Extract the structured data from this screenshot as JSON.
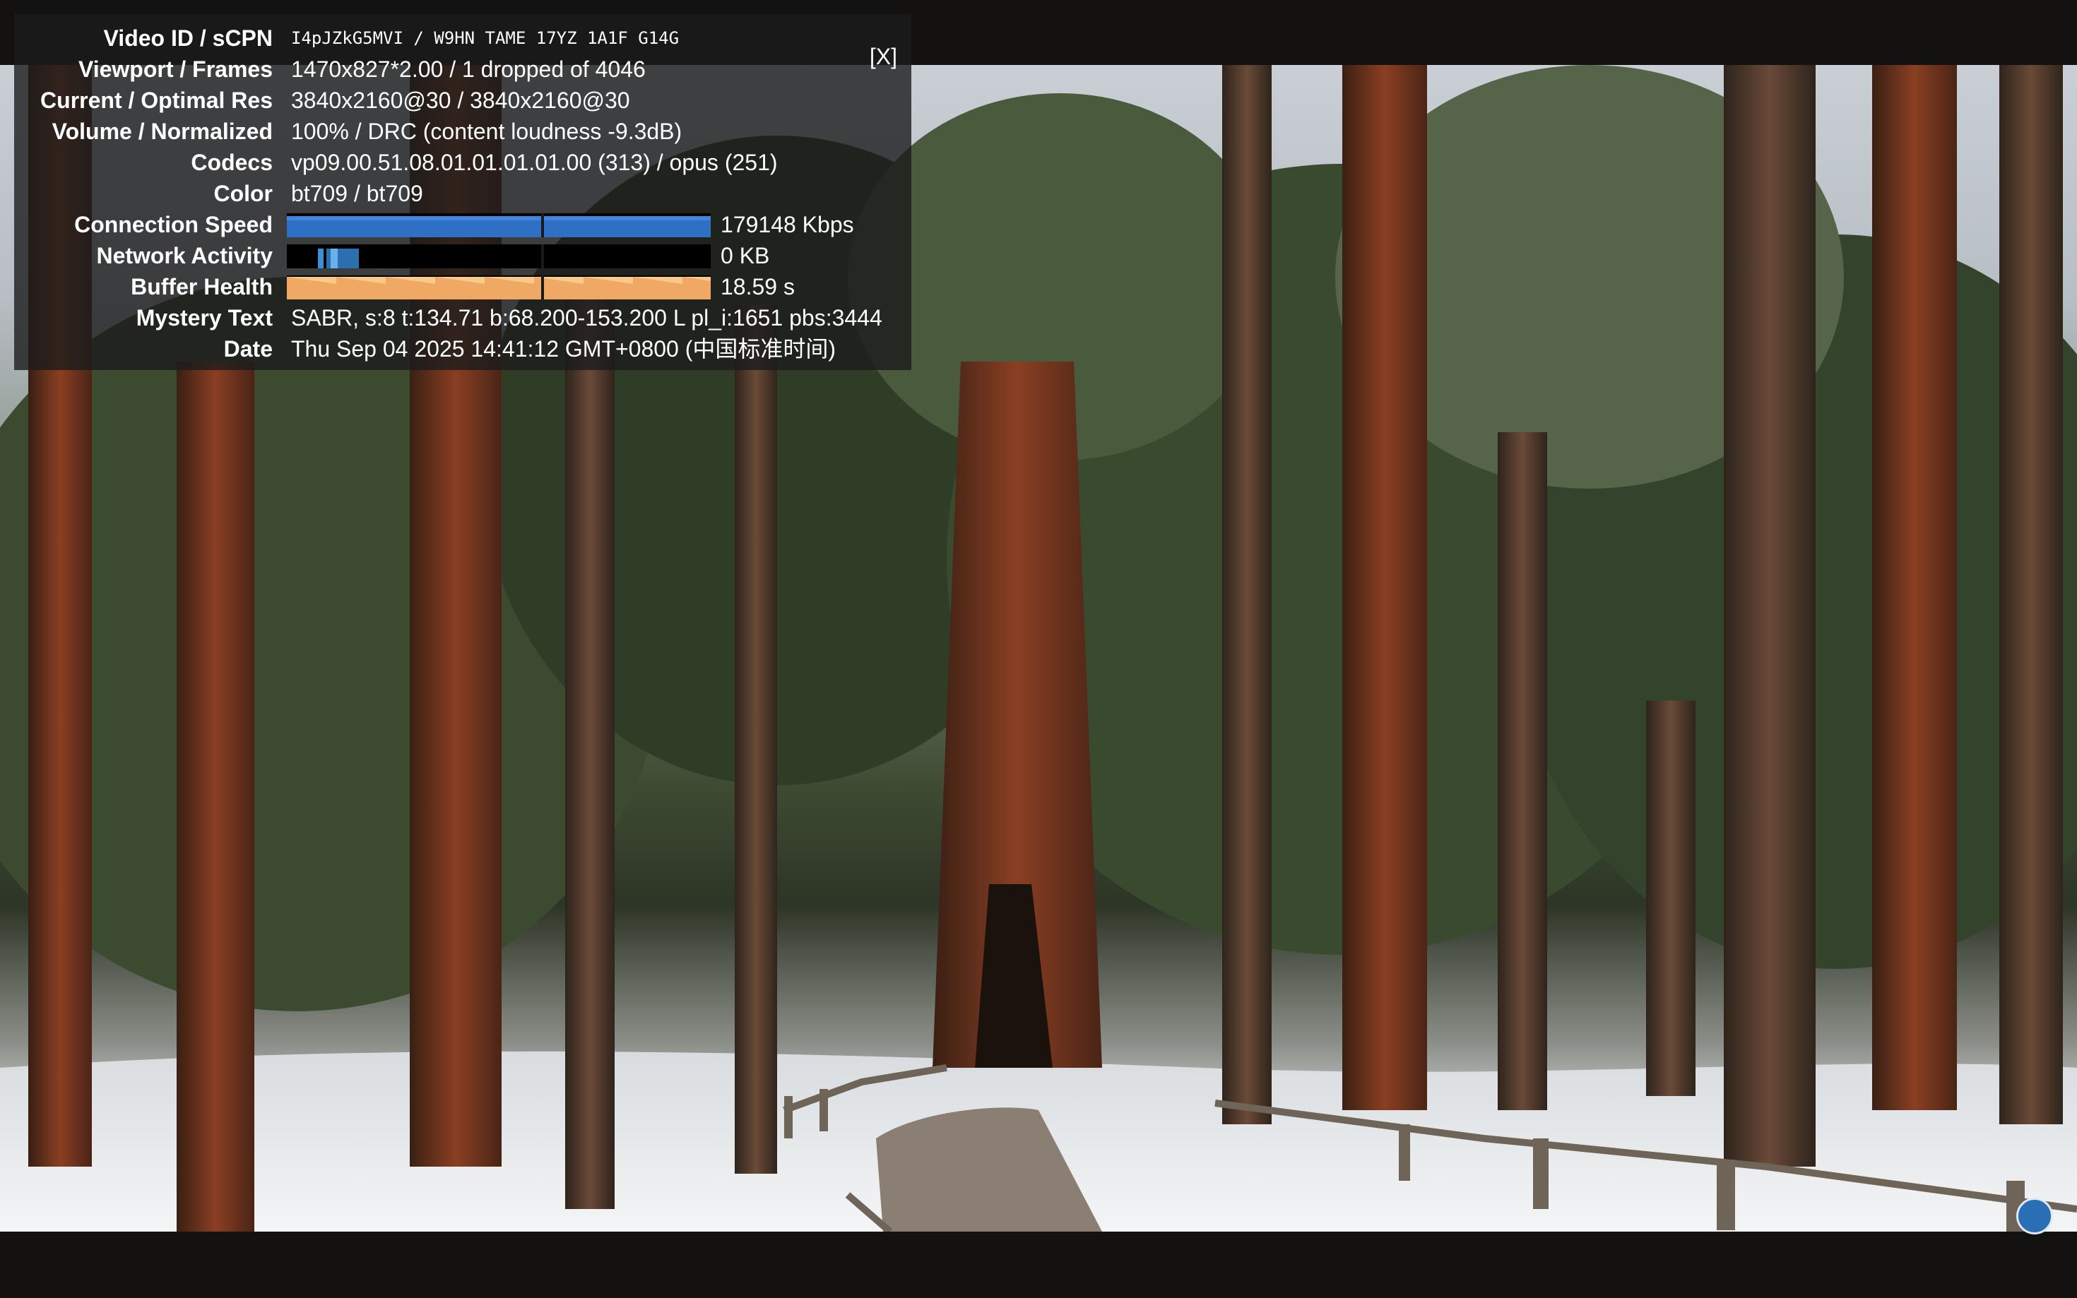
{
  "stats": {
    "close_label": "[X]",
    "rows": [
      {
        "label": "Video ID / sCPN",
        "value": "I4pJZkG5MVI / W9HN TAME 17YZ 1A1F G14G"
      },
      {
        "label": "Viewport / Frames",
        "value": "1470x827*2.00 / 1 dropped of 4046"
      },
      {
        "label": "Current / Optimal Res",
        "value": "3840x2160@30 / 3840x2160@30"
      },
      {
        "label": "Volume / Normalized",
        "value": "100% / DRC (content loudness -9.3dB)"
      },
      {
        "label": "Codecs",
        "value": "vp09.00.51.08.01.01.01.01.00 (313) / opus (251)"
      },
      {
        "label": "Color",
        "value": "bt709 / bt709"
      },
      {
        "label": "Connection Speed",
        "value": "179148 Kbps"
      },
      {
        "label": "Network Activity",
        "value": "0 KB"
      },
      {
        "label": "Buffer Health",
        "value": "18.59 s"
      },
      {
        "label": "Mystery Text",
        "value": "SABR, s:8 t:134.71 b:68.200-153.200 L pl_i:1651 pbs:3444"
      },
      {
        "label": "Date",
        "value": "Thu Sep 04 2025 14:41:12 GMT+0800 (中国标准时间)"
      }
    ]
  },
  "colors": {
    "connection_graph": "#2f6fc4",
    "network_graph": "#3c8fd6",
    "buffer_graph": "#f0a865",
    "panel_background": "#1c1c1c"
  },
  "icons": {
    "close": "close-icon",
    "channel_badge": "channel-badge-icon"
  }
}
